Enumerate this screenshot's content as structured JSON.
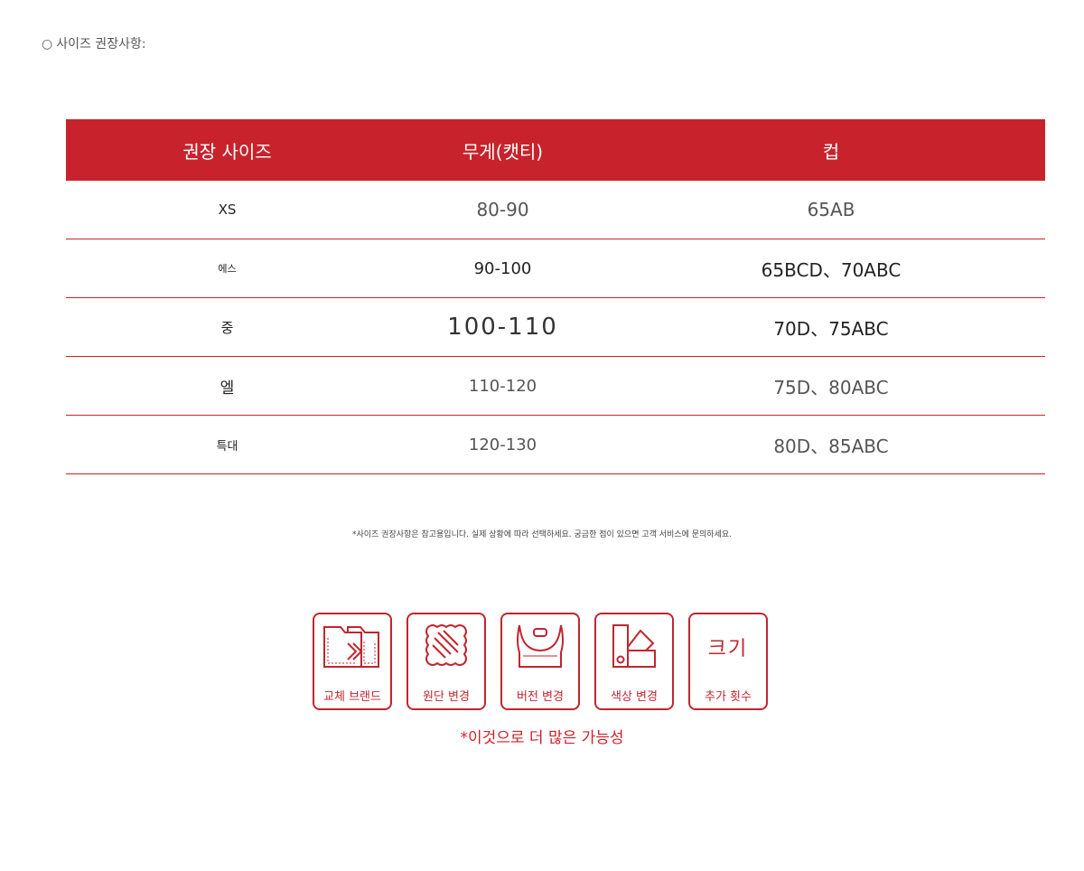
{
  "heading": {
    "bullet": "○",
    "text": "사이즈 권장사항:"
  },
  "table": {
    "header_color": "#c8232c",
    "headers": [
      "권장 사이즈",
      "무게(캣티)",
      "컵"
    ],
    "rows": [
      [
        "XS",
        "80-90",
        "65AB"
      ],
      [
        "에스",
        "90-100",
        "65BCD、70ABC"
      ],
      [
        "중",
        "100-110",
        "70D、75ABC"
      ],
      [
        "엘",
        "110-120",
        "75D、80ABC"
      ],
      [
        "특대",
        "120-130",
        "80D、85ABC"
      ]
    ]
  },
  "note": "*사이즈 권장사항은 참고용입니다. 실제 상황에 따라 선택하세요. 궁금한 점이 있으면 고객 서비스에 문의하세요.",
  "features": [
    {
      "icon": "folder-replace-icon",
      "label": "교체 브랜드"
    },
    {
      "icon": "fabric-icon",
      "label": "원단 변경"
    },
    {
      "icon": "bra-icon",
      "label": "버전 변경"
    },
    {
      "icon": "color-swatch-icon",
      "label": "색상 변경"
    },
    {
      "icon": "size-text-icon",
      "big_text": "크기",
      "label": "추가 횟수"
    }
  ],
  "tagline": "*이것으로 더 많은 가능성",
  "accent_color": "#c0262f"
}
